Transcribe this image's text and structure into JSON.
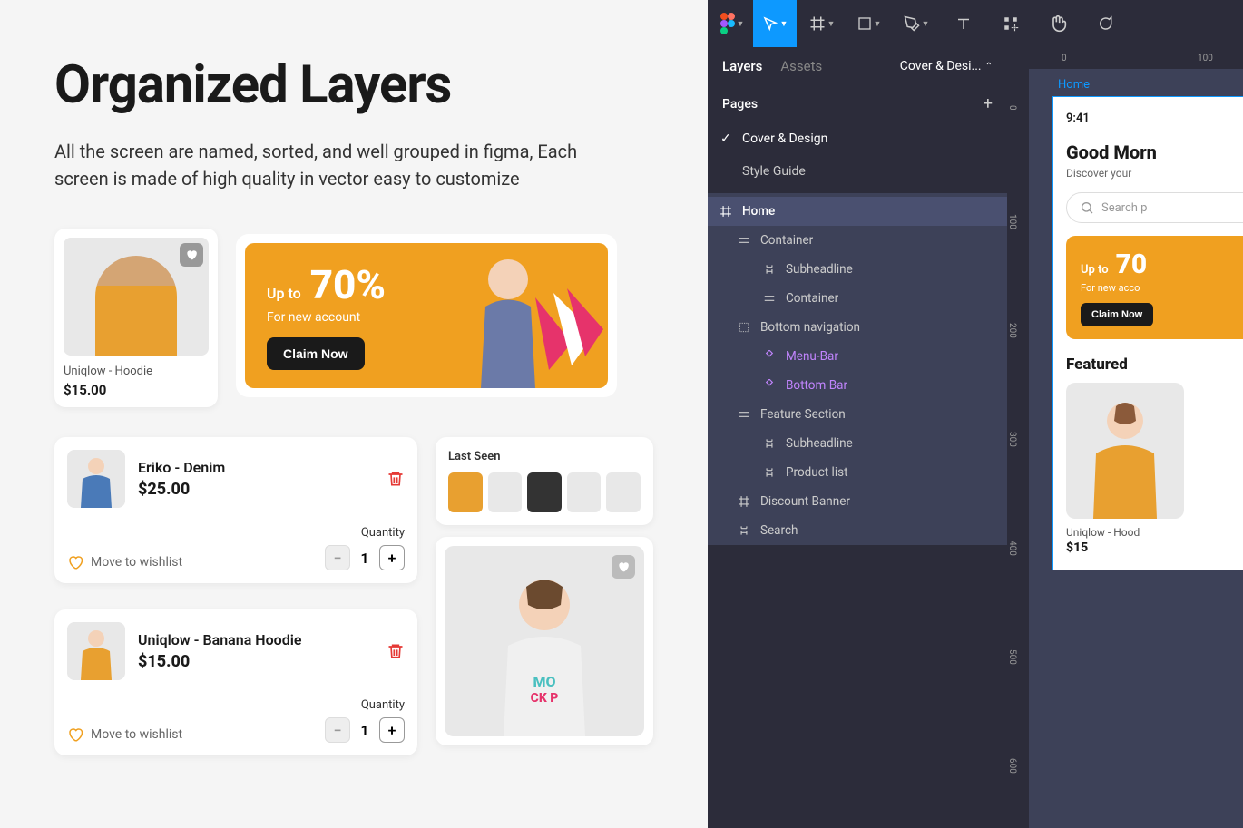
{
  "left": {
    "title": "Organized Layers",
    "subtitle": "All the screen are named, sorted, and well grouped in figma, Each screen is made of high quality in vector easy to customize",
    "product1": {
      "name": "Uniqlow - Hoodie",
      "price": "$15.00"
    },
    "promo": {
      "upto": "Up to",
      "pct": "70%",
      "sub": "For new account",
      "cta": "Claim Now"
    },
    "cart1": {
      "name": "Eriko - Denim",
      "price": "$25.00",
      "wishlist": "Move to wishlist",
      "qty_label": "Quantity",
      "qty": "1"
    },
    "cart2": {
      "name": "Uniqlow - Banana Hoodie",
      "price": "$15.00",
      "wishlist": "Move to wishlist",
      "qty_label": "Quantity",
      "qty": "1"
    },
    "last_seen": "Last Seen"
  },
  "figma": {
    "tabs": {
      "layers": "Layers",
      "assets": "Assets"
    },
    "file": "Cover & Desi...",
    "pages_label": "Pages",
    "pages": [
      "Cover & Design",
      "Style Guide"
    ],
    "layers": [
      {
        "name": "Home",
        "type": "frame",
        "indent": 0,
        "root": true
      },
      {
        "name": "Container",
        "type": "autolayout",
        "indent": 1
      },
      {
        "name": "Subheadline",
        "type": "text",
        "indent": 2
      },
      {
        "name": "Container",
        "type": "autolayout",
        "indent": 2
      },
      {
        "name": "Bottom navigation",
        "type": "group",
        "indent": 1
      },
      {
        "name": "Menu-Bar",
        "type": "component",
        "indent": 2
      },
      {
        "name": "Bottom Bar",
        "type": "component",
        "indent": 2
      },
      {
        "name": "Feature Section",
        "type": "autolayout",
        "indent": 1
      },
      {
        "name": "Subheadline",
        "type": "text",
        "indent": 2
      },
      {
        "name": "Product list",
        "type": "text",
        "indent": 2
      },
      {
        "name": "Discount Banner",
        "type": "frame",
        "indent": 1
      },
      {
        "name": "Search",
        "type": "text",
        "indent": 1
      }
    ],
    "ruler_h": {
      "t0": "0",
      "t100": "100"
    },
    "ruler_v": {
      "t0": "0",
      "t100": "100",
      "t200": "200",
      "t300": "300",
      "t400": "400",
      "t500": "500",
      "t600": "600"
    }
  },
  "artboard": {
    "frame_label": "Home",
    "time": "9:41",
    "greeting": "Good Morn",
    "sub": "Discover your",
    "search": "Search p",
    "promo": {
      "upto": "Up to",
      "pct": "70",
      "sub": "For new acco",
      "cta": "Claim Now"
    },
    "featured": "Featured",
    "product": {
      "name": "Uniqlow - Hood",
      "price": "$15"
    }
  }
}
